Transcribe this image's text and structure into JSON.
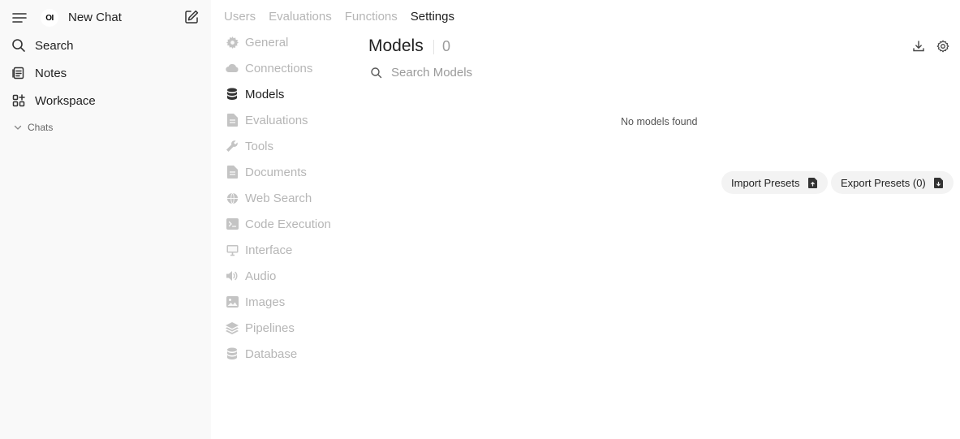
{
  "sidebar": {
    "new_chat_label": "New Chat",
    "logo_text": "OI",
    "items": [
      {
        "label": "Search",
        "icon": "search-icon"
      },
      {
        "label": "Notes",
        "icon": "notes-icon"
      },
      {
        "label": "Workspace",
        "icon": "workspace-icon"
      }
    ],
    "chats_label": "Chats"
  },
  "header": {
    "tabs": [
      {
        "label": "Users",
        "active": false
      },
      {
        "label": "Evaluations",
        "active": false
      },
      {
        "label": "Functions",
        "active": false
      },
      {
        "label": "Settings",
        "active": true
      }
    ]
  },
  "settings_nav": {
    "items": [
      {
        "label": "General",
        "icon": "gear-icon",
        "active": false
      },
      {
        "label": "Connections",
        "icon": "cloud-icon",
        "active": false
      },
      {
        "label": "Models",
        "icon": "database-icon",
        "active": true
      },
      {
        "label": "Evaluations",
        "icon": "document-icon",
        "active": false
      },
      {
        "label": "Tools",
        "icon": "wrench-icon",
        "active": false
      },
      {
        "label": "Documents",
        "icon": "document-icon",
        "active": false
      },
      {
        "label": "Web Search",
        "icon": "globe-icon",
        "active": false
      },
      {
        "label": "Code Execution",
        "icon": "terminal-icon",
        "active": false
      },
      {
        "label": "Interface",
        "icon": "monitor-icon",
        "active": false
      },
      {
        "label": "Audio",
        "icon": "speaker-icon",
        "active": false
      },
      {
        "label": "Images",
        "icon": "image-icon",
        "active": false
      },
      {
        "label": "Pipelines",
        "icon": "layers-icon",
        "active": false
      },
      {
        "label": "Database",
        "icon": "database-icon",
        "active": false
      }
    ]
  },
  "main": {
    "title": "Models",
    "count": "0",
    "search_placeholder": "Search Models",
    "search_value": "",
    "empty_message": "No models found",
    "import_label": "Import Presets",
    "export_label": "Export Presets (0)"
  },
  "colors": {
    "sidebar_bg": "#f9f9f9",
    "active_text": "#1f1f1f",
    "muted_text": "#b6b6b6",
    "pill_bg": "#f3f3f3"
  }
}
